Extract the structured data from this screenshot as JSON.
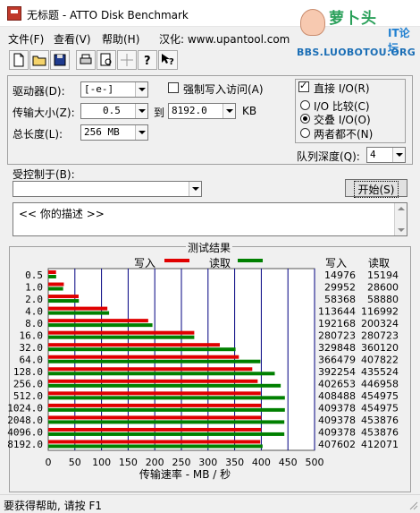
{
  "window": {
    "title": "无标题 - ATTO Disk Benchmark"
  },
  "brand": {
    "name": "萝卜头",
    "tag": "IT论坛",
    "url": "BBS.LUOBOTOU.ORG"
  },
  "menu": [
    {
      "label": "文件(F)"
    },
    {
      "label": "查看(V)"
    },
    {
      "label": "帮助(H)"
    },
    {
      "label": "汉化: www.upantool.com"
    }
  ],
  "toolbar": {
    "buttons": [
      "new-icon",
      "open-icon",
      "save-icon",
      "print-icon",
      "print-preview-icon",
      "move-icon",
      "help-icon",
      "context-help-icon"
    ]
  },
  "settings": {
    "drive_label": "驱动器(D):",
    "drive_value": "[-e-]",
    "force_write_label": "强制写入访问(A)",
    "transfer_label": "传输大小(Z):",
    "transfer_from": "0.5",
    "transfer_to_label": "到",
    "transfer_to": "8192.0",
    "transfer_unit": "KB",
    "total_label": "总长度(L):",
    "total_value": "256 MB",
    "direct_io_label": "直接 I/O(R)",
    "io_compare_label": "I/O 比较(C)",
    "overlapped_io_label": "交叠 I/O(O)",
    "neither_label": "两者都不(N)",
    "queue_label": "队列深度(Q):",
    "queue_value": "4",
    "controlled_label": "受控制于(B):",
    "controlled_value": "",
    "start_label": "开始(S)"
  },
  "description": {
    "text": "<<  你的描述  >>"
  },
  "results": {
    "title": "测试结果",
    "write_legend": "写入",
    "read_legend": "读取",
    "col_write": "写入",
    "col_read": "读取",
    "rows": [
      {
        "size": "0.5",
        "write": "14976",
        "read": "15194"
      },
      {
        "size": "1.0",
        "write": "29952",
        "read": "28600"
      },
      {
        "size": "2.0",
        "write": "58368",
        "read": "58880"
      },
      {
        "size": "4.0",
        "write": "113644",
        "read": "116992"
      },
      {
        "size": "8.0",
        "write": "192168",
        "read": "200324"
      },
      {
        "size": "16.0",
        "write": "280723",
        "read": "280723"
      },
      {
        "size": "32.0",
        "write": "329848",
        "read": "360120"
      },
      {
        "size": "64.0",
        "write": "366479",
        "read": "407822"
      },
      {
        "size": "128.0",
        "write": "392254",
        "read": "435524"
      },
      {
        "size": "256.0",
        "write": "402653",
        "read": "446958"
      },
      {
        "size": "512.0",
        "write": "408488",
        "read": "454975"
      },
      {
        "size": "1024.0",
        "write": "409378",
        "read": "454975"
      },
      {
        "size": "2048.0",
        "write": "409378",
        "read": "453876"
      },
      {
        "size": "4096.0",
        "write": "409378",
        "read": "453876"
      },
      {
        "size": "8192.0",
        "write": "407602",
        "read": "412071"
      }
    ],
    "xlabel": "传输速率 - MB / 秒"
  },
  "chart_data": {
    "type": "bar",
    "orientation": "horizontal",
    "categories": [
      "0.5",
      "1.0",
      "2.0",
      "4.0",
      "8.0",
      "16.0",
      "32.0",
      "64.0",
      "128.0",
      "256.0",
      "512.0",
      "1024.0",
      "2048.0",
      "4096.0",
      "8192.0"
    ],
    "series": [
      {
        "name": "写入",
        "color": "#e00000",
        "values_kb_s": [
          14976,
          29952,
          58368,
          113644,
          192168,
          280723,
          329848,
          366479,
          392254,
          402653,
          408488,
          409378,
          409378,
          409378,
          407602
        ]
      },
      {
        "name": "读取",
        "color": "#008000",
        "values_kb_s": [
          15194,
          28600,
          58880,
          116992,
          200324,
          280723,
          360120,
          407822,
          435524,
          446958,
          454975,
          454975,
          453876,
          453876,
          412071
        ]
      }
    ],
    "xticks": [
      "0",
      "50",
      "100",
      "150",
      "200",
      "250",
      "300",
      "350",
      "400",
      "450",
      "500"
    ],
    "xlim": [
      0,
      500
    ],
    "xlabel": "传输速率 - MB / 秒",
    "grid": true,
    "grid_color": "#000080"
  },
  "status": {
    "text": "要获得帮助, 请按 F1"
  }
}
